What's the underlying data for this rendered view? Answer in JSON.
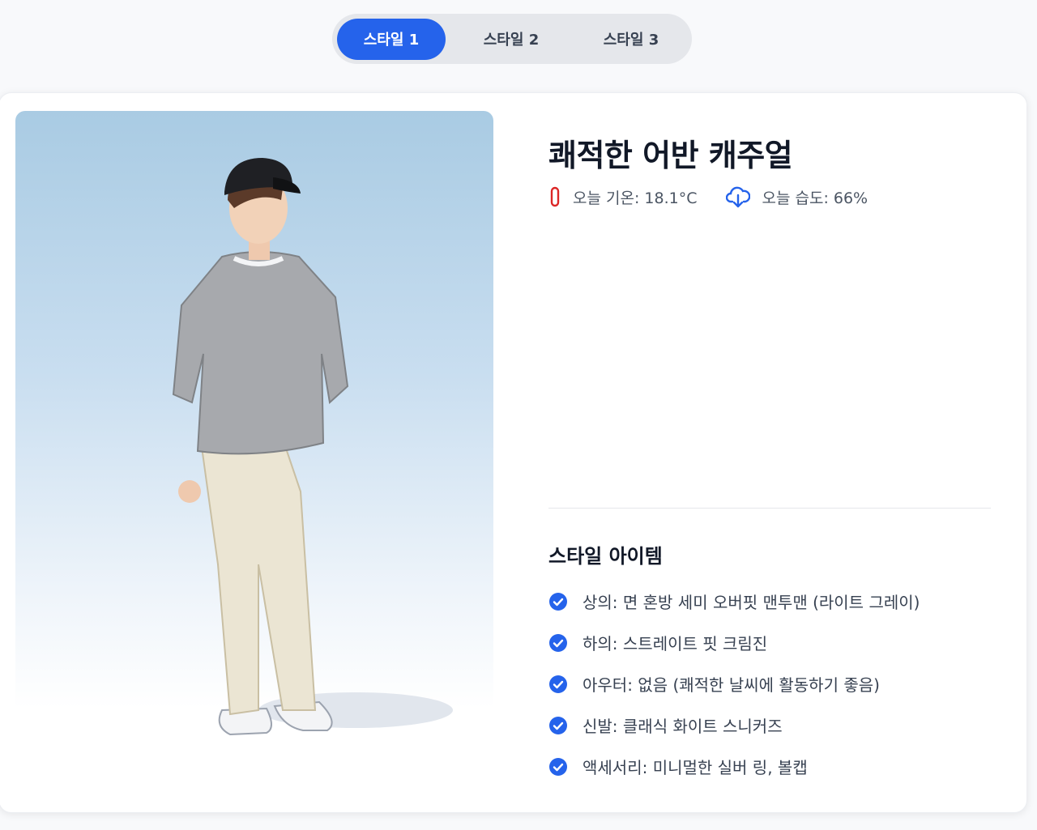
{
  "tabs": [
    {
      "label": "스타일 1",
      "active": true
    },
    {
      "label": "스타일 2",
      "active": false
    },
    {
      "label": "스타일 3",
      "active": false
    }
  ],
  "outfit": {
    "title": "쾌적한 어반 캐주얼",
    "temperature": {
      "icon": "thermometer-icon",
      "text": "오늘 기온: 18.1°C",
      "color": "#dc2626"
    },
    "humidity": {
      "icon": "cloud-download-icon",
      "text": "오늘 습도: 66%",
      "color": "#2563eb"
    },
    "items_heading": "스타일 아이템",
    "items": [
      "상의: 면 혼방 세미 오버핏 맨투맨 (라이트 그레이)",
      "하의: 스트레이트 핏 크림진",
      "아우터: 없음 (쾌적한 날씨에 활동하기 좋음)",
      "신발: 클래식 화이트 스니커즈",
      "액세서리: 미니멀한 실버 링, 볼캡"
    ]
  },
  "colors": {
    "accent": "#2563eb",
    "check": "#2563eb",
    "tab_bg": "#e5e7eb"
  }
}
